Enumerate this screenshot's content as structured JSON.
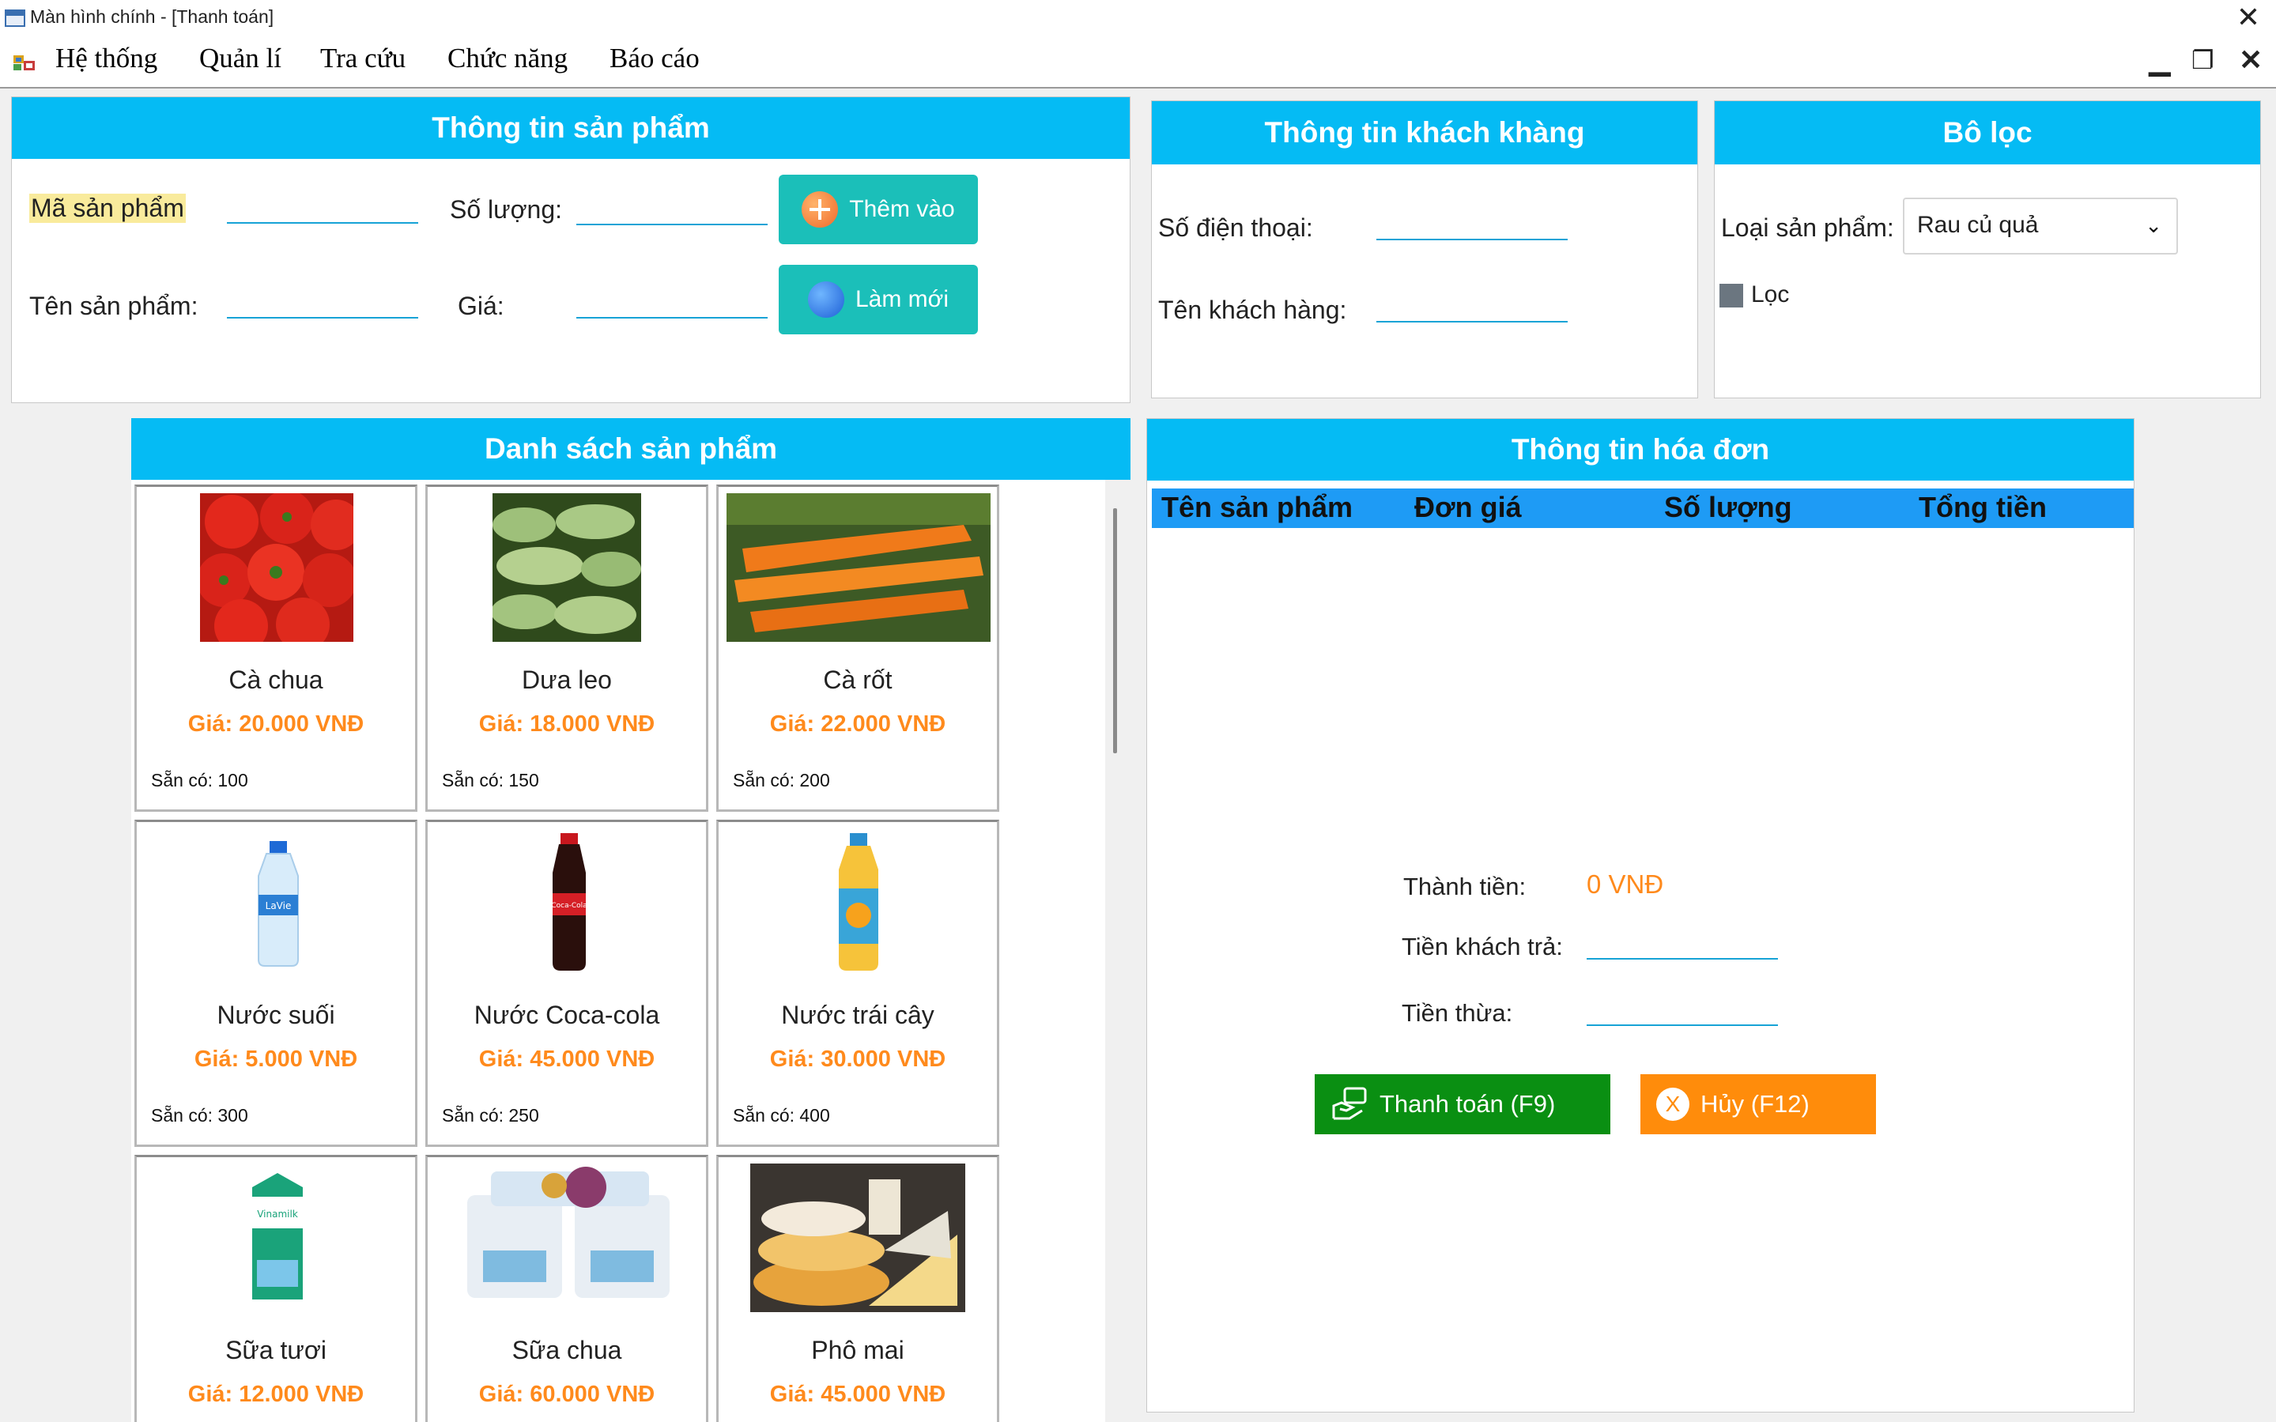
{
  "window": {
    "title": "Màn hình chính - [Thanh toán]"
  },
  "menu": {
    "items": [
      "Hệ thống",
      "Quản lí",
      "Tra cứu",
      "Chức năng",
      "Báo cáo"
    ]
  },
  "product_info": {
    "header": "Thông tin sản phẩm",
    "code_label": "Mã sản phẩm",
    "name_label": "Tên sản phẩm:",
    "qty_label": "Số lượng:",
    "price_label": "Giá:",
    "add_button": "Thêm vào",
    "refresh_button": "Làm mới",
    "code_value": "",
    "name_value": "",
    "qty_value": "",
    "price_value": ""
  },
  "customer_info": {
    "header": "Thông tin khách khàng",
    "phone_label": "Số điện thoại:",
    "name_label": "Tên khách hàng:",
    "phone_value": "",
    "name_value": ""
  },
  "filter": {
    "header": "Bô lọc",
    "category_label": "Loại sản phẩm:",
    "category_selected": "Rau củ quả",
    "filter_checkbox_label": "Lọc"
  },
  "product_list": {
    "header": "Danh sách sản phẩm",
    "items": [
      {
        "name": "Cà chua",
        "price": "Giá: 20.000 VNĐ",
        "stock": "Sẵn có: 100",
        "icon": "tomato-image"
      },
      {
        "name": "Dưa leo",
        "price": "Giá: 18.000 VNĐ",
        "stock": "Sẵn có: 150",
        "icon": "cucumber-image"
      },
      {
        "name": "Cà rốt",
        "price": "Giá: 22.000 VNĐ",
        "stock": "Sẵn có: 200",
        "icon": "carrot-image"
      },
      {
        "name": "Nước suối",
        "price": "Giá: 5.000 VNĐ",
        "stock": "Sẵn có: 300",
        "icon": "water-bottle-image"
      },
      {
        "name": "Nước Coca-cola",
        "price": "Giá: 45.000 VNĐ",
        "stock": "Sẵn có: 250",
        "icon": "coca-cola-bottle-image"
      },
      {
        "name": "Nước trái cây",
        "price": "Giá: 30.000 VNĐ",
        "stock": "Sẵn có: 400",
        "icon": "juice-bottle-image"
      },
      {
        "name": "Sữa tươi",
        "price": "Giá: 12.000 VNĐ",
        "icon": "milk-carton-image"
      },
      {
        "name": "Sữa chua",
        "price": "Giá: 60.000 VNĐ",
        "icon": "yogurt-image"
      },
      {
        "name": "Phô mai",
        "price": "Giá: 45.000 VNĐ",
        "icon": "cheese-image"
      }
    ]
  },
  "invoice": {
    "header": "Thông tin hóa đơn",
    "columns": [
      "Tên sản phẩm",
      "Đơn giá",
      "Số lượng",
      "Tổng tiền"
    ],
    "rows": [],
    "total_label": "Thành tiền:",
    "total_value": "0 VNĐ",
    "paid_label": "Tiền khách trả:",
    "paid_value": "",
    "change_label": "Tiền thừa:",
    "change_value": "",
    "pay_button": "Thanh toán (F9)",
    "cancel_button": "Hủy (F12)"
  },
  "colors": {
    "header_blue": "#05bbf4",
    "table_header_blue": "#1e9bf5",
    "teal_button": "#1bbfb9",
    "price_orange": "#ff8a1c",
    "pay_green": "#0a8f12",
    "cancel_orange": "#ff8c0b",
    "highlight_yellow": "#f9eb9c"
  }
}
